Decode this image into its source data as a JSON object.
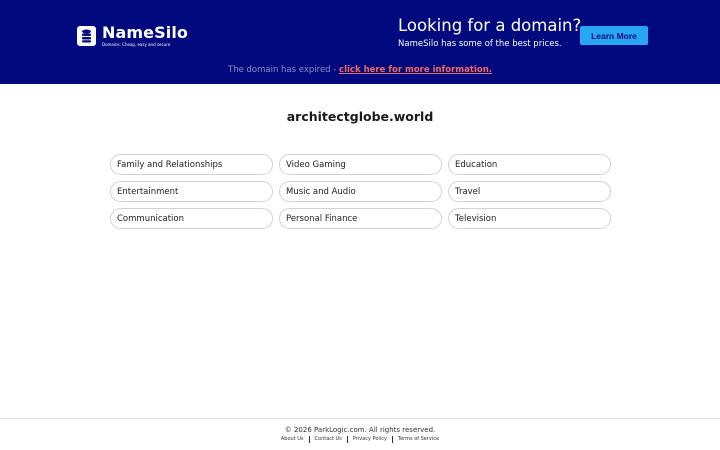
{
  "header": {
    "logo_name": "NameSilo",
    "logo_tagline": "Domains. Cheap, easy and secure",
    "promo_title": "Looking for a domain?",
    "promo_subtitle": "NameSilo has some of the best prices.",
    "learn_more": "Learn More",
    "expired_text": "The domain has expired - ",
    "expired_link": "click here for more information.",
    "colors": {
      "background": "#01097f",
      "button": "#27a6f3",
      "link": "#ef6a63"
    }
  },
  "main": {
    "domain": "architectglobe.world",
    "categories": [
      "Family and Relationships",
      "Video Gaming",
      "Education",
      "Entertainment",
      "Music and Audio",
      "Travel",
      "Communication",
      "Personal Finance",
      "Television"
    ]
  },
  "footer": {
    "copyright": "© 2026 ParkLogic.com. All rights reserved.",
    "links": [
      "About Us",
      "Contact Us",
      "Privacy Policy",
      "Terms of Service"
    ]
  }
}
